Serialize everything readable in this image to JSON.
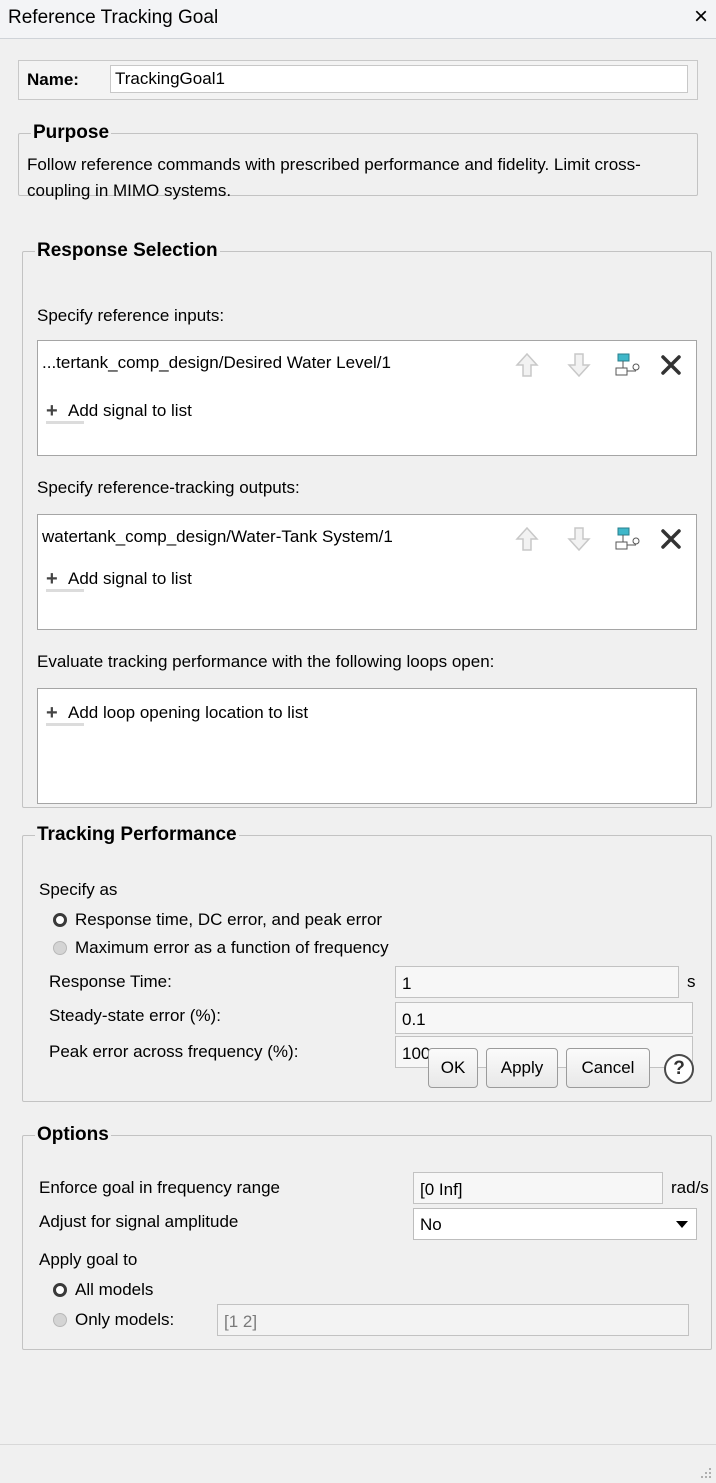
{
  "window": {
    "title": "Reference Tracking Goal",
    "close_glyph": "×"
  },
  "name": {
    "label": "Name:",
    "value": "TrackingGoal1"
  },
  "purpose": {
    "legend": "Purpose",
    "text": "Follow reference commands with prescribed performance and fidelity. Limit cross-coupling in MIMO systems."
  },
  "response_selection": {
    "legend": "Response Selection",
    "inputs_label": "Specify reference inputs:",
    "inputs_signal": "...tertank_comp_design/Desired  Water Level/1",
    "outputs_label": "Specify reference-tracking outputs:",
    "outputs_signal": "watertank_comp_design/Water-Tank System/1",
    "add_signal_label": "Add signal to list",
    "loops_label": "Evaluate tracking performance with the following loops open:",
    "add_loop_label": "Add loop opening location to list",
    "plus_glyph": "+"
  },
  "tracking_performance": {
    "legend": "Tracking Performance",
    "specify_as": "Specify as",
    "option1": "Response time, DC error, and peak error",
    "option2": "Maximum error as a function of frequency",
    "selected": "option1",
    "response_time_label": "Response Time:",
    "response_time_value": "1",
    "response_time_unit": "s",
    "steady_state_label": "Steady-state error (%):",
    "steady_state_value": "0.1",
    "peak_error_label": "Peak error across frequency (%):",
    "peak_error_value": "100"
  },
  "options": {
    "legend": "Options",
    "freq_range_label": "Enforce goal in frequency range",
    "freq_range_value": "[0 Inf]",
    "freq_range_unit": "rad/s",
    "amplitude_label": "Adjust for signal amplitude",
    "amplitude_value": "No",
    "apply_goal_label": "Apply goal to",
    "all_models": "All models",
    "only_models": "Only models:",
    "only_models_value": "[1 2]",
    "selected": "all_models"
  },
  "buttons": {
    "ok": "OK",
    "apply": "Apply",
    "cancel": "Cancel",
    "help_glyph": "?"
  },
  "icons": [
    "move-up-icon",
    "move-down-icon",
    "select-signal-icon",
    "delete-icon",
    "plus-icon",
    "help-icon",
    "close-icon",
    "resize-grip-icon"
  ]
}
